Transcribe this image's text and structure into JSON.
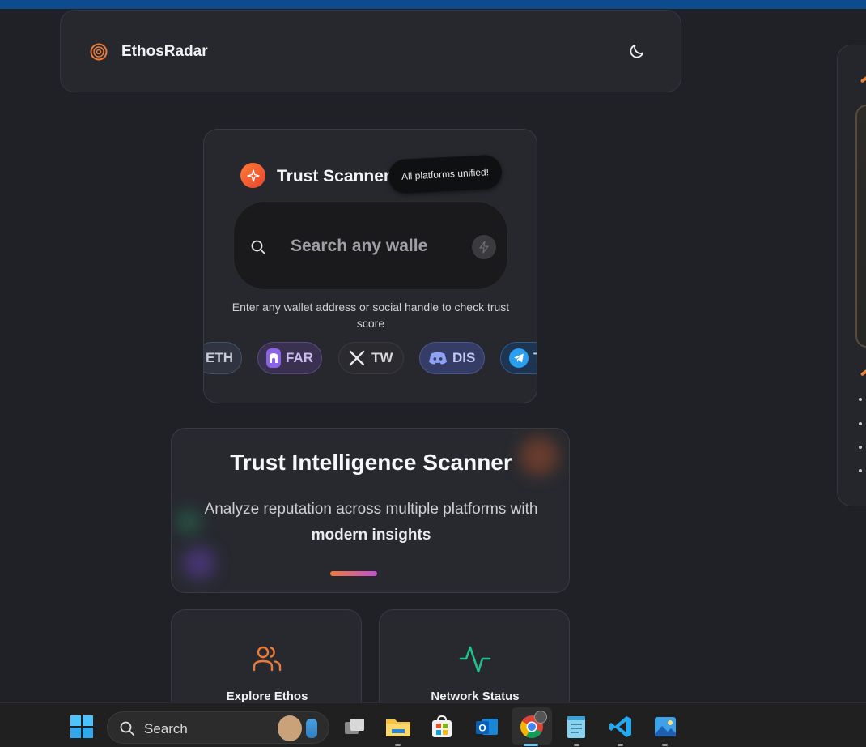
{
  "header": {
    "brand": "EthosRadar",
    "theme_icon": "moon-icon"
  },
  "scanner": {
    "title": "Trust Scanner",
    "badge": "All platforms unified!",
    "search_placeholder": "Search any walle",
    "helper": "Enter any wallet address or social handle to check trust score",
    "platforms": [
      {
        "label": "ETH",
        "icon": "ethereum-icon"
      },
      {
        "label": "FAR",
        "icon": "farcaster-icon"
      },
      {
        "label": "TW",
        "icon": "x-twitter-icon"
      },
      {
        "label": "DIS",
        "icon": "discord-icon"
      },
      {
        "label": "T",
        "icon": "telegram-icon"
      }
    ]
  },
  "intel": {
    "title": "Trust Intelligence Scanner",
    "subtitle_start": "Analyze reputation across multiple platforms with",
    "subtitle_bold": "modern insights"
  },
  "cards": [
    {
      "label": "Explore Ethos",
      "icon": "users-icon"
    },
    {
      "label": "Network Status",
      "icon": "activity-icon"
    }
  ],
  "taskbar": {
    "search_label": "Search"
  },
  "colors": {
    "accent": "#f07a36",
    "bg": "#1f2127",
    "card": "#26282e",
    "green": "#22c08a"
  }
}
